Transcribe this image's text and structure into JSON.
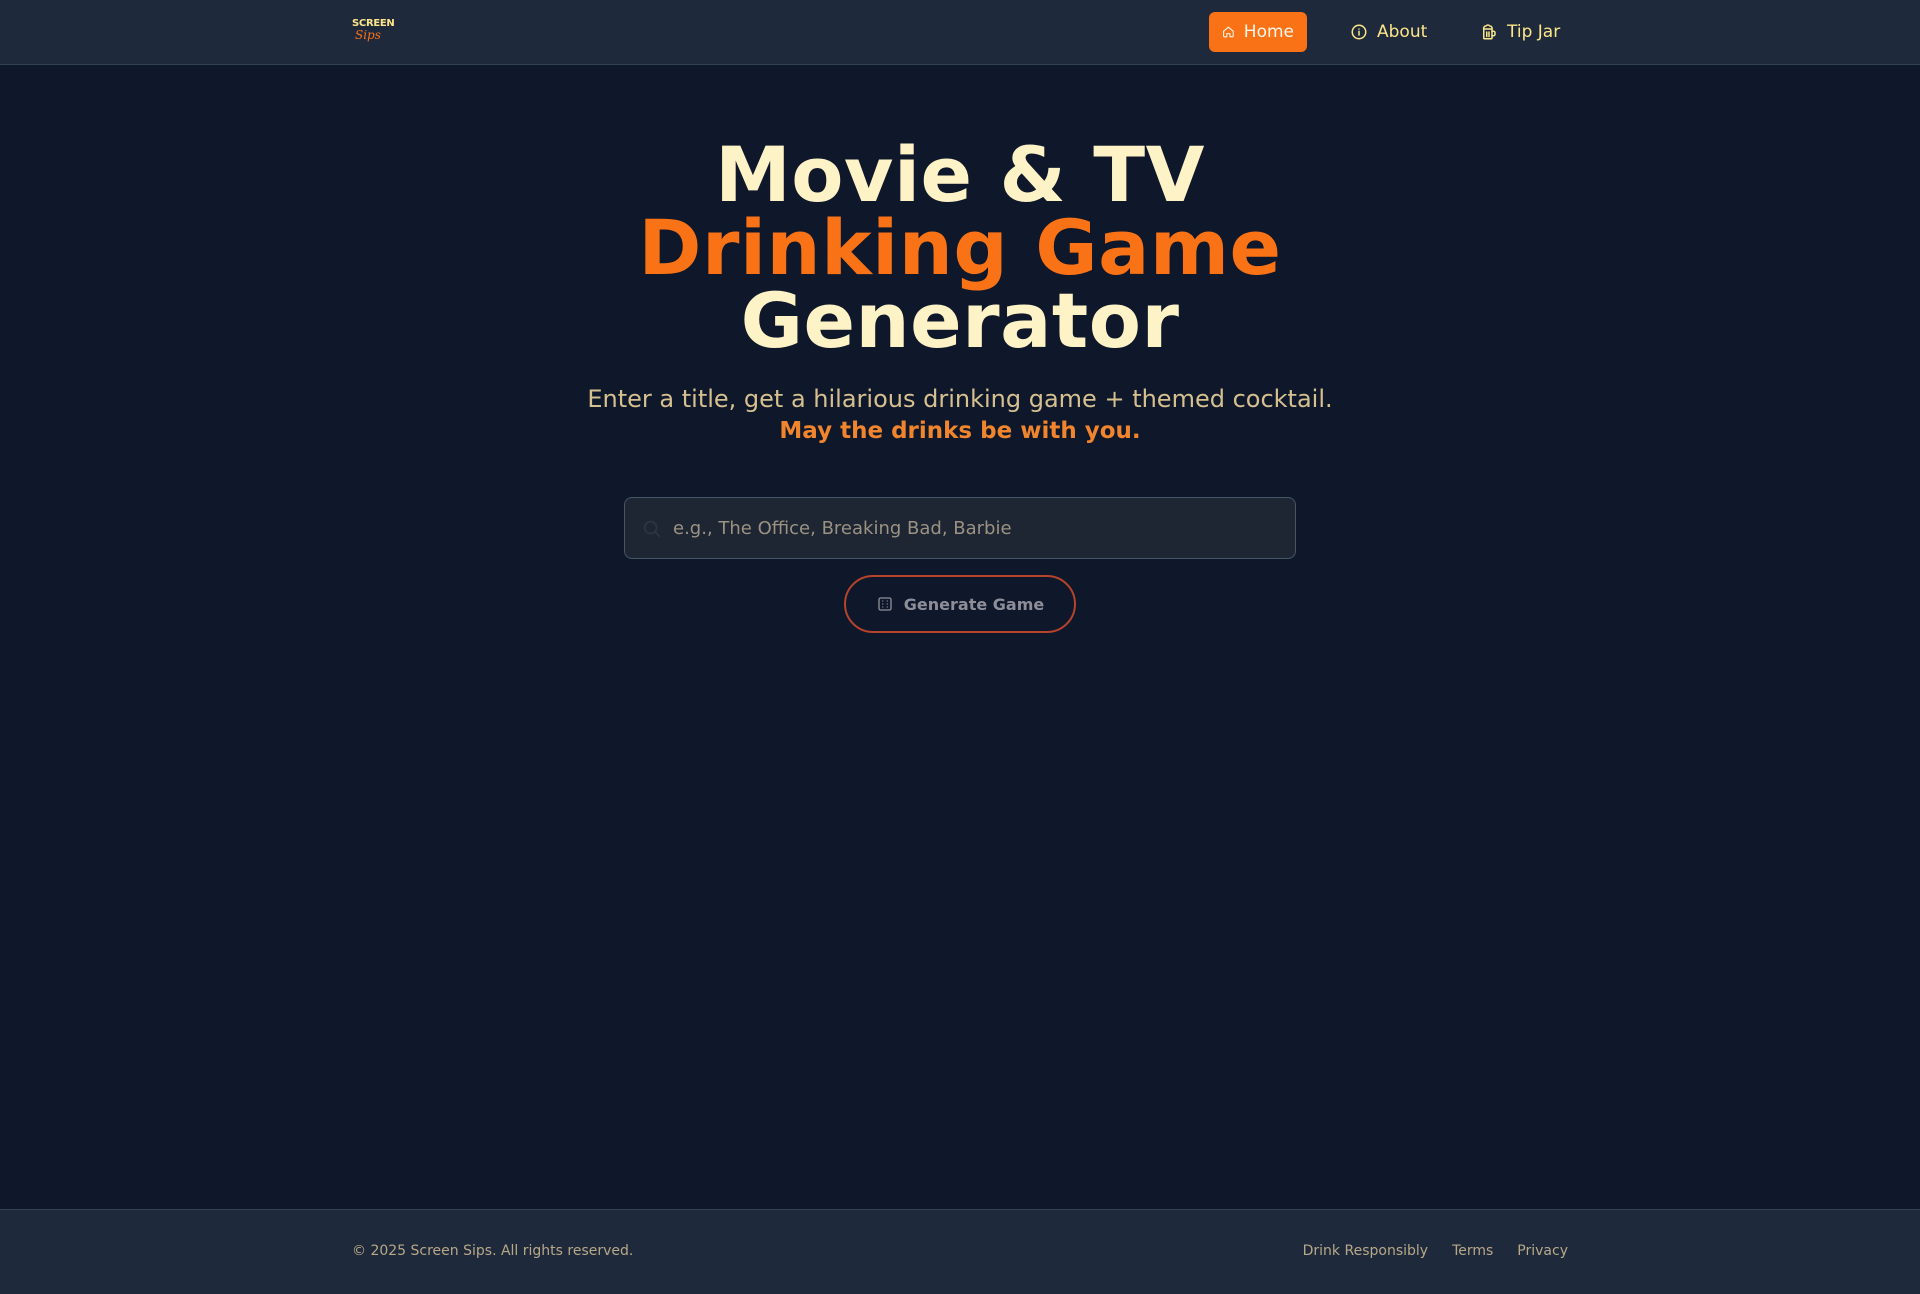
{
  "nav": {
    "logo": {
      "line1": "SCREEN",
      "line2": "Sips"
    },
    "items": [
      {
        "label": "Home",
        "icon": "home-icon",
        "active": true
      },
      {
        "label": "About",
        "icon": "info-icon",
        "active": false
      },
      {
        "label": "Tip Jar",
        "icon": "beer-mug-icon",
        "active": false
      }
    ]
  },
  "hero": {
    "title_line1": "Movie & TV",
    "title_line2": "Drinking Game",
    "title_line3": "Generator",
    "subtitle": "Enter a title, get a hilarious drinking game + themed cocktail.",
    "tagline": "May the drinks be with you."
  },
  "search": {
    "value": "",
    "placeholder": "e.g., The Office, Breaking Bad, Barbie",
    "icon": "search-icon"
  },
  "generate_button": {
    "label": "Generate Game",
    "icon": "dice-icon"
  },
  "footer": {
    "copyright": "© 2025 Screen Sips. All rights reserved.",
    "links": [
      "Drink Responsibly",
      "Terms",
      "Privacy"
    ]
  },
  "colors": {
    "background": "#0f172a",
    "navbar": "#1e293b",
    "accent": "#f97316",
    "title": "#fef3c7"
  }
}
